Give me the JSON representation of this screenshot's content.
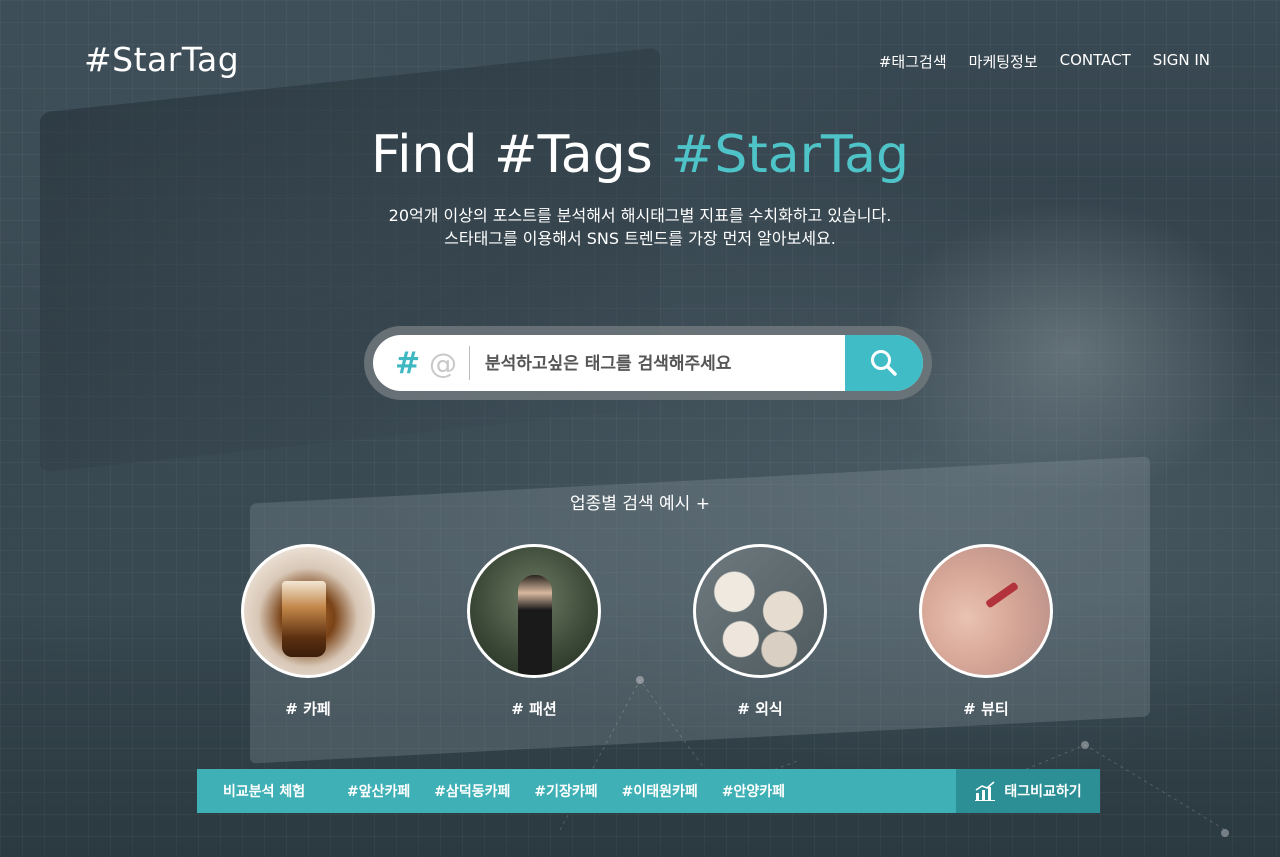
{
  "header": {
    "logo": "#StarTag",
    "nav": [
      "#태그검색",
      "마케팅정보",
      "CONTACT",
      "SIGN IN"
    ]
  },
  "hero": {
    "title_part1": "Find #Tags",
    "title_part2": "#StarTag",
    "subtitle_line1": "20억개 이상의 포스트를 분석해서 해시태그별 지표를 수치화하고 있습니다.",
    "subtitle_line2": "스타태그를 이용해서 SNS 트렌드를 가장 먼저 알아보세요."
  },
  "search": {
    "hash_symbol": "#",
    "at_symbol": "@",
    "placeholder": "분석하고싶은 태그를 검색해주세요",
    "value": ""
  },
  "examples": {
    "title": "업종별 검색 예시 +",
    "categories": [
      {
        "label": "# 카페"
      },
      {
        "label": "# 패션"
      },
      {
        "label": "# 외식"
      },
      {
        "label": "# 뷰티"
      }
    ]
  },
  "compare_bar": {
    "label": "비교분석 체험",
    "tags": [
      "#앞산카페",
      "#삼덕동카페",
      "#기장카페",
      "#이태원카페",
      "#안양카페"
    ],
    "button": "태그비교하기"
  },
  "colors": {
    "accent": "#4fc4c8",
    "search_button": "#3fbcc6",
    "bar": "#3fb0b6",
    "bar_button": "#2b8f95"
  }
}
